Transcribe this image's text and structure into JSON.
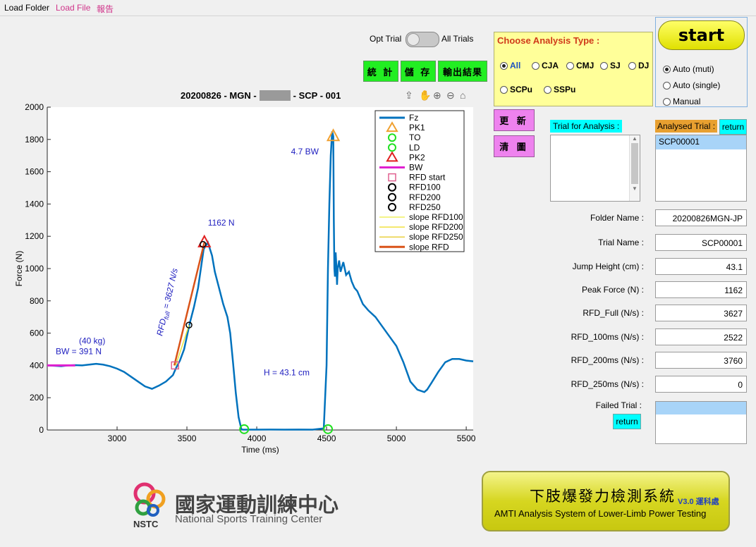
{
  "menu": {
    "items": [
      "Load Folder",
      "Load File",
      "報告"
    ]
  },
  "toggle": {
    "left_label": "Opt Trial",
    "right_label": "All Trials"
  },
  "buttons": {
    "stats": "統 計",
    "save": "儲 存",
    "export": "輸出結果",
    "update": "更 新",
    "clear": "清 圖",
    "start": "start",
    "return_analysed": "return",
    "return_failed": "return"
  },
  "analysis_type": {
    "title": "Choose Analysis Type :",
    "options": [
      "All",
      "CJA",
      "CMJ",
      "SJ",
      "DJ",
      "SCPu",
      "SSPu"
    ],
    "selected": "All"
  },
  "mode": {
    "options": [
      "Auto (muti)",
      "Auto (single)",
      "Manual"
    ],
    "selected": "Auto (muti)"
  },
  "panels": {
    "trial_for_analysis": "Trial for Analysis :",
    "analysed_trial": "Analysed Trial :",
    "analysed_items": [
      "SCP00001"
    ],
    "failed_trial": "Failed Trial :"
  },
  "fields": [
    {
      "label": "Folder Name :",
      "value": "20200826MGN-JP"
    },
    {
      "label": "Trial Name :",
      "value": "SCP00001"
    },
    {
      "label": "Jump Height (cm) :",
      "value": "43.1"
    },
    {
      "label": "Peak Force (N) :",
      "value": "1162"
    },
    {
      "label": "RFD_Full (N/s) :",
      "value": "3627"
    },
    {
      "label": "RFD_100ms (N/s) :",
      "value": "2522"
    },
    {
      "label": "RFD_200ms (N/s) :",
      "value": "3760"
    },
    {
      "label": "RFD_250ms (N/s) :",
      "value": "0"
    }
  ],
  "chart_data": {
    "type": "line",
    "title_left": "20200826 - MGN -",
    "title_right": "- SCP - 001",
    "xlabel": "Time (ms)",
    "ylabel": "Force (N)",
    "xlim": [
      2500,
      5550
    ],
    "ylim": [
      0,
      2000
    ],
    "xticks": [
      3000,
      3500,
      4000,
      4500,
      5000,
      5500
    ],
    "yticks": [
      0,
      200,
      400,
      600,
      800,
      1000,
      1200,
      1400,
      1600,
      1800,
      2000
    ],
    "series": [
      {
        "name": "Fz",
        "color": "#0072bd",
        "x": [
          2500,
          2550,
          2600,
          2650,
          2700,
          2750,
          2800,
          2850,
          2900,
          2950,
          3000,
          3050,
          3100,
          3150,
          3200,
          3250,
          3300,
          3350,
          3400,
          3420,
          3450,
          3480,
          3500,
          3520,
          3550,
          3580,
          3600,
          3620,
          3650,
          3680,
          3700,
          3730,
          3760,
          3790,
          3810,
          3830,
          3850,
          3870,
          3890,
          3900,
          3950,
          4000,
          4100,
          4200,
          4300,
          4400,
          4480,
          4500,
          4510,
          4520,
          4530,
          4540,
          4548,
          4552,
          4556,
          4560,
          4565,
          4570,
          4575,
          4580,
          4590,
          4600,
          4620,
          4640,
          4660,
          4680,
          4700,
          4720,
          4740,
          4760,
          4780,
          4800,
          4850,
          4900,
          4950,
          5000,
          5050,
          5100,
          5150,
          5200,
          5220,
          5250,
          5300,
          5350,
          5400,
          5450,
          5500,
          5550
        ],
        "y": [
          400,
          398,
          395,
          400,
          402,
          400,
          405,
          410,
          405,
          395,
          380,
          360,
          330,
          300,
          270,
          255,
          275,
          300,
          340,
          380,
          430,
          500,
          580,
          660,
          760,
          880,
          1000,
          1120,
          1162,
          1080,
          980,
          880,
          780,
          700,
          600,
          420,
          230,
          80,
          5,
          2,
          2,
          2,
          3,
          2,
          3,
          2,
          10,
          400,
          1000,
          1400,
          1700,
          1850,
          1820,
          1300,
          1000,
          950,
          1100,
          1020,
          900,
          1000,
          1050,
          980,
          1040,
          960,
          980,
          920,
          880,
          860,
          820,
          780,
          760,
          740,
          700,
          640,
          580,
          520,
          420,
          300,
          250,
          235,
          250,
          290,
          360,
          420,
          440,
          440,
          430,
          425
        ]
      },
      {
        "name": "slope RFD",
        "color": "#d95319",
        "x": [
          3410,
          3625
        ],
        "y": [
          400,
          1162
        ]
      }
    ],
    "markers": {
      "PK1": {
        "x": 4548,
        "y": 1820,
        "label": "4.7 BW"
      },
      "PK2": {
        "x": 3625,
        "y": 1162,
        "label": "1162 N"
      },
      "TO": {
        "x": 3910,
        "y": 5
      },
      "LD": {
        "x": 4510,
        "y": 5
      },
      "RFD_start": {
        "x": 3415,
        "y": 400
      },
      "RFD100": {
        "x": 3515,
        "y": 650
      },
      "RFD200": {
        "x": 3615,
        "y": 1150
      }
    },
    "bw": {
      "x0": 2500,
      "x1": 2700,
      "y": 400,
      "label": "BW = 391 N",
      "kg": "(40 kg)"
    },
    "annotations": {
      "height": "H = 43.1 cm",
      "rfd_full_text": "= 3627 N/s",
      "rfd_sub": "full",
      "rfd_main": "RFD"
    },
    "legend": [
      "Fz",
      "PK1",
      "TO",
      "LD",
      "PK2",
      "BW",
      "RFD start",
      "RFD100",
      "RFD200",
      "RFD250",
      "slope RFD100",
      "slope RFD200",
      "slope RFD250",
      "slope RFD"
    ]
  },
  "logo": {
    "cn": "國家運動訓練中心",
    "en": "National Sports Training Center",
    "abbr": "NSTC"
  },
  "banner": {
    "cn": "下肢爆發力檢測系統",
    "version": "V3.0 運科處",
    "en": "AMTI Analysis System of Lower-Limb Power Testing"
  }
}
